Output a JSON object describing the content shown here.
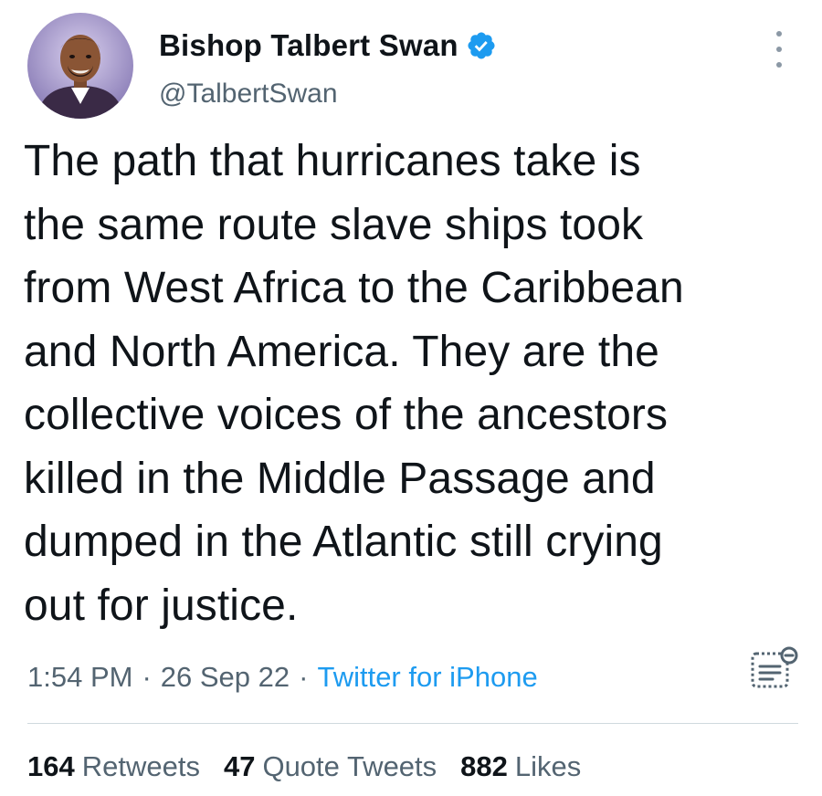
{
  "author": {
    "display_name": "Bishop Talbert Swan",
    "handle": "@TalbertSwan",
    "verified": true,
    "avatar_icon": "profile-photo"
  },
  "tweet": {
    "text": "The path that hurricanes take is\nthe same route slave ships took\nfrom West Africa to the Caribbean\nand North America. They are the\ncollective voices of the ancestors\nkilled in the Middle Passage and\ndumped in the Atlantic still crying\nout for justice.",
    "time": "1:54 PM",
    "separator": "·",
    "date": "26 Sep 22",
    "source": "Twitter for iPhone"
  },
  "stats": {
    "retweets_count": "164",
    "retweets_label": "Retweets",
    "quotes_count": "47",
    "quotes_label": "Quote Tweets",
    "likes_count": "882",
    "likes_label": "Likes"
  },
  "icons": {
    "more": "more-vertical-icon",
    "verified": "verified-badge-icon",
    "analytics": "view-analytics-icon"
  },
  "colors": {
    "accent": "#1d9bf0",
    "text_primary": "#0f1419",
    "text_secondary": "#536471"
  }
}
